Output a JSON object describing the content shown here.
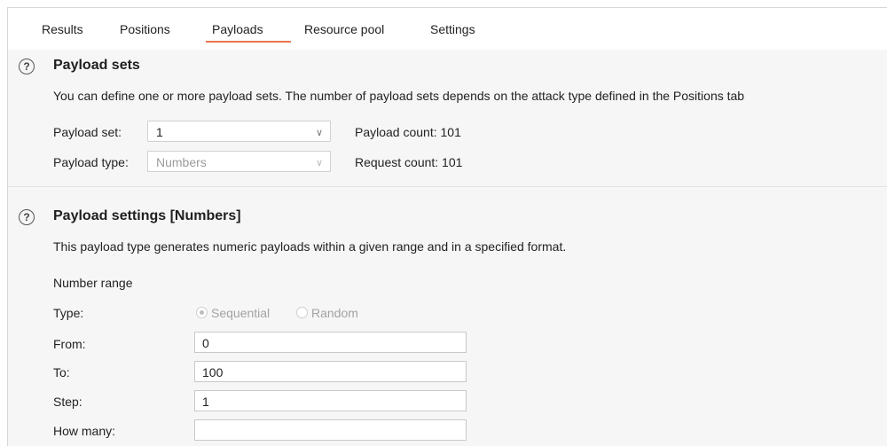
{
  "tabs": [
    {
      "label": "Results"
    },
    {
      "label": "Positions"
    },
    {
      "label": "Payloads"
    },
    {
      "label": "Resource pool"
    },
    {
      "label": "Settings"
    }
  ],
  "active_tab": "Payloads",
  "payload_sets": {
    "help_glyph": "?",
    "heading": "Payload sets",
    "description": "You can define one or more payload sets. The number of payload sets depends on the attack type defined in the Positions tab",
    "payload_set_label": "Payload set:",
    "payload_set_value": "1",
    "payload_type_label": "Payload type:",
    "payload_type_value": "Numbers",
    "payload_count": "Payload count: 101",
    "request_count": "Request count: 101"
  },
  "payload_settings": {
    "help_glyph": "?",
    "heading": "Payload settings [Numbers]",
    "description": "This payload type generates numeric payloads within a given range and in a specified format.",
    "number_range_label": "Number range",
    "type_label": "Type:",
    "type_options": [
      "Sequential",
      "Random"
    ],
    "type_selected": "Sequential",
    "from_label": "From:",
    "from_value": "0",
    "to_label": "To:",
    "to_value": "100",
    "step_label": "Step:",
    "step_value": "1",
    "how_many_label": "How many:",
    "how_many_value": ""
  },
  "icons": {
    "select_chevron": "chevron-down-icon",
    "help": "help-icon"
  },
  "colors": {
    "active_tab_underline": "#e8764e",
    "panel_background": "#f6f6f6"
  }
}
